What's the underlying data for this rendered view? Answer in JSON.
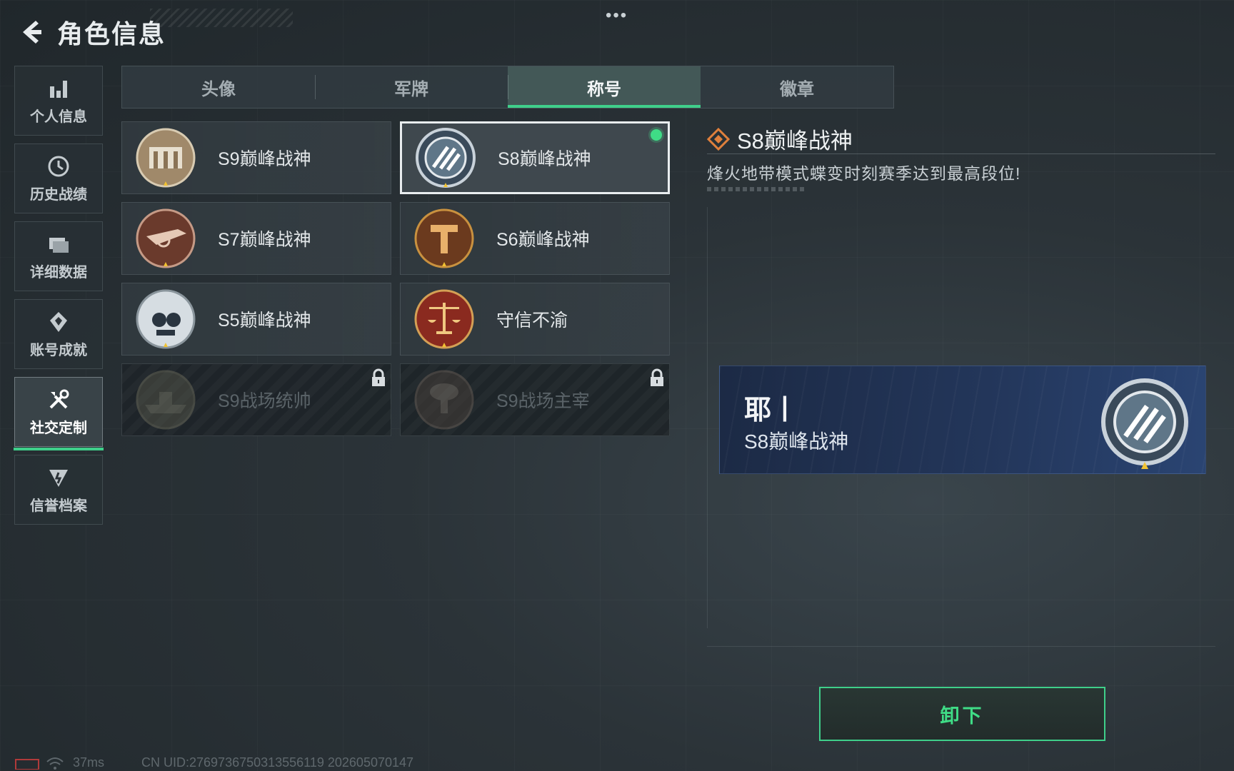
{
  "header": {
    "title": "角色信息"
  },
  "sidebar": {
    "items": [
      {
        "label": "个人信息",
        "icon": "bar-chart-icon",
        "active": false
      },
      {
        "label": "历史战绩",
        "icon": "clock-icon",
        "active": false
      },
      {
        "label": "详细数据",
        "icon": "folder-icon",
        "active": false
      },
      {
        "label": "账号成就",
        "icon": "achievement-icon",
        "active": false
      },
      {
        "label": "社交定制",
        "icon": "tools-icon",
        "active": true
      },
      {
        "label": "信誉档案",
        "icon": "reputation-icon",
        "active": false
      }
    ]
  },
  "tabs": [
    {
      "label": "头像",
      "active": false
    },
    {
      "label": "军牌",
      "active": false
    },
    {
      "label": "称号",
      "active": true
    },
    {
      "label": "徽章",
      "active": false
    }
  ],
  "titles": [
    {
      "name": "S9巅峰战神",
      "medal": "s9-medal-icon",
      "selected": false,
      "locked": false
    },
    {
      "name": "S8巅峰战神",
      "medal": "s8-medal-icon",
      "selected": true,
      "locked": false,
      "equipped": true
    },
    {
      "name": "S7巅峰战神",
      "medal": "s7-medal-icon",
      "selected": false,
      "locked": false
    },
    {
      "name": "S6巅峰战神",
      "medal": "s6-medal-icon",
      "selected": false,
      "locked": false
    },
    {
      "name": "S5巅峰战神",
      "medal": "s5-medal-icon",
      "selected": false,
      "locked": false
    },
    {
      "name": "守信不渝",
      "medal": "scales-medal-icon",
      "selected": false,
      "locked": false
    },
    {
      "name": "S9战场统帅",
      "medal": "ship-medal-icon",
      "selected": false,
      "locked": true
    },
    {
      "name": "S9战场主宰",
      "medal": "mushroom-cloud-medal-icon",
      "selected": false,
      "locked": true
    }
  ],
  "detail": {
    "title": "S8巅峰战神",
    "description": "烽火地带模式蝶变时刻赛季达到最高段位!"
  },
  "preview": {
    "player_name": "耶丨",
    "title": "S8巅峰战神"
  },
  "actions": {
    "unequip_label": "卸下"
  },
  "footer": {
    "ping": "37ms",
    "uid": "CN UID:2769736750313556119 202605070147"
  },
  "colors": {
    "accent": "#3fcf8a",
    "equipped_dot": "#3fdc86",
    "preview_bg": "#23365a"
  }
}
